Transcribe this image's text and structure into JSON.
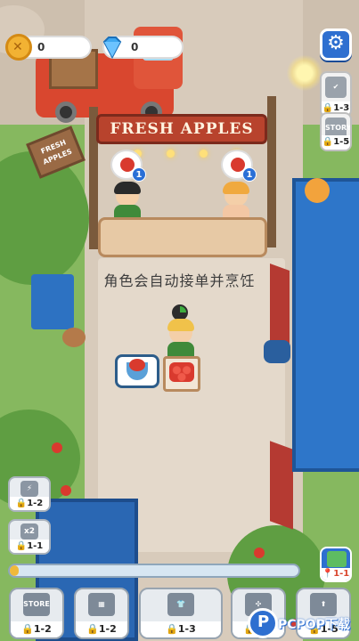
{
  "currencies": {
    "coins": {
      "icon": "coin-icon",
      "value": "0"
    },
    "gems": {
      "icon": "gem-icon",
      "value": "0"
    }
  },
  "shop": {
    "banner_text": "FRESH APPLES",
    "sign_text": "FRESH APPLES"
  },
  "orders": [
    {
      "icon": "apple-basket-icon",
      "count": "1"
    },
    {
      "icon": "apple-basket-icon",
      "count": "1"
    }
  ],
  "caption": "角色会自动接单并烹饪",
  "right_side_buttons": [
    {
      "icon": "checklist-icon",
      "level": "1-3"
    },
    {
      "icon": "story-icon",
      "label": "STORY",
      "level": "1-5"
    }
  ],
  "left_side_buttons": [
    {
      "icon": "battery-icon",
      "level": "1-2"
    },
    {
      "icon": "double-speed-icon",
      "label": "x2",
      "level": "1-1"
    }
  ],
  "map_button": {
    "icon": "map-icon",
    "level": "1-1"
  },
  "bottom_bar": [
    {
      "icon": "store-icon",
      "label": "STORE",
      "level": "1-2"
    },
    {
      "icon": "machine-icon",
      "level": "1-2"
    },
    {
      "icon": "shirt-icon",
      "level": "1-3"
    },
    {
      "icon": "fan-icon",
      "level": "1-4"
    },
    {
      "icon": "upgrade-arrow-icon",
      "level": "1-5"
    }
  ],
  "progress": {
    "fraction": 0.03
  },
  "watermark": {
    "text": "PCPOP下载"
  },
  "colors": {
    "accent_blue": "#2e6fd0",
    "banner_red": "#b8432d",
    "progress_fill": "#f0b93a"
  }
}
